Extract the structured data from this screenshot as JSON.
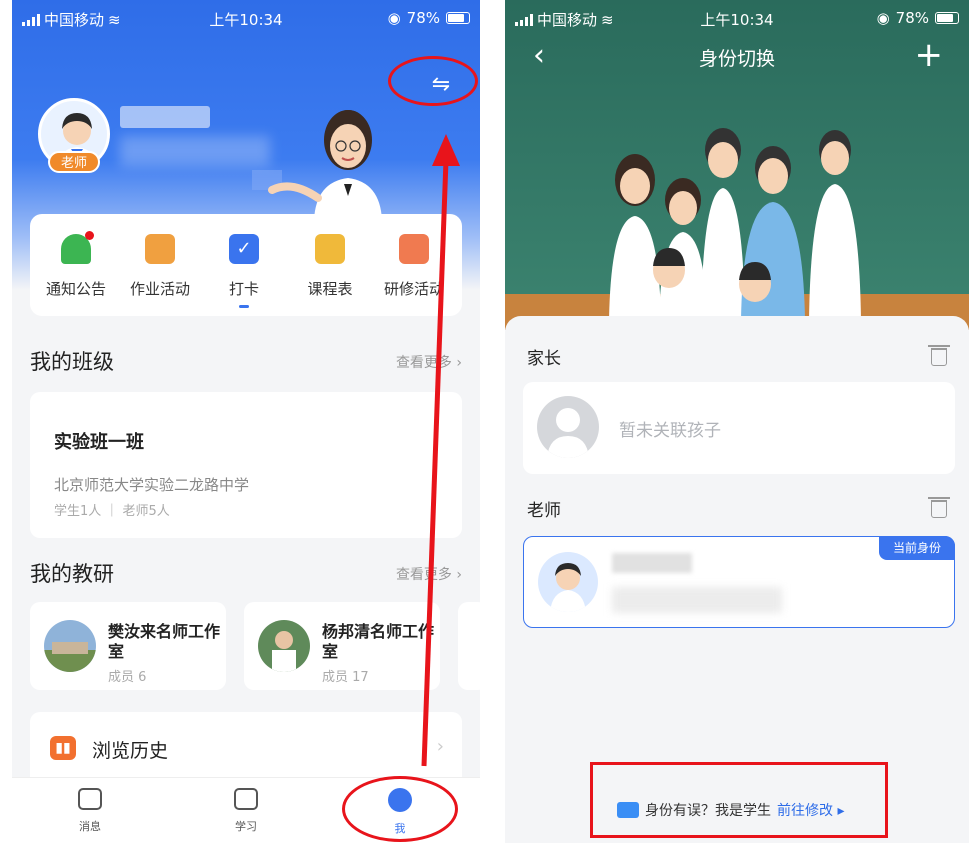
{
  "status_bar": {
    "carrier": "中国移动",
    "time": "上午10:34",
    "battery": "78%"
  },
  "left": {
    "role_badge": "老师",
    "quick_actions": [
      {
        "label": "通知公告",
        "icon": "bell-icon",
        "color": "#3cb552"
      },
      {
        "label": "作业活动",
        "icon": "document-icon",
        "color": "#f0a040"
      },
      {
        "label": "打卡",
        "icon": "checkin-icon",
        "color": "#3a74ee"
      },
      {
        "label": "课程表",
        "icon": "calendar-icon",
        "color": "#f0b93a"
      },
      {
        "label": "研修活动",
        "icon": "flag-icon",
        "color": "#f07a50"
      }
    ],
    "my_class": {
      "title": "我的班级",
      "more": "查看更多",
      "class_name": "实验班一班",
      "school": "北京师范大学实验二龙路中学",
      "stats": "学生1人 ｜ 老师5人"
    },
    "my_research": {
      "title": "我的教研",
      "more": "查看更多",
      "studios": [
        {
          "name": "樊汝来名师工作室",
          "members": "成员 6"
        },
        {
          "name": "杨邦清名师工作室",
          "members": "成员 17"
        }
      ]
    },
    "history": {
      "label": "浏览历史",
      "icon": "book-icon"
    },
    "tabs": [
      {
        "label": "消息",
        "icon": "message-icon"
      },
      {
        "label": "学习",
        "icon": "book-open-icon"
      },
      {
        "label": "我",
        "icon": "profile-icon"
      }
    ],
    "accent": "#3a74ee"
  },
  "right": {
    "nav": {
      "title": "身份切换",
      "back": "‹",
      "add": "+"
    },
    "parent_group": {
      "title": "家长",
      "empty_text": "暂未关联孩子"
    },
    "teacher_group": {
      "title": "老师",
      "current_badge": "当前身份"
    },
    "wrong_identity": {
      "question": "身份有误？我是学生",
      "link": "前往修改 ▸"
    }
  }
}
